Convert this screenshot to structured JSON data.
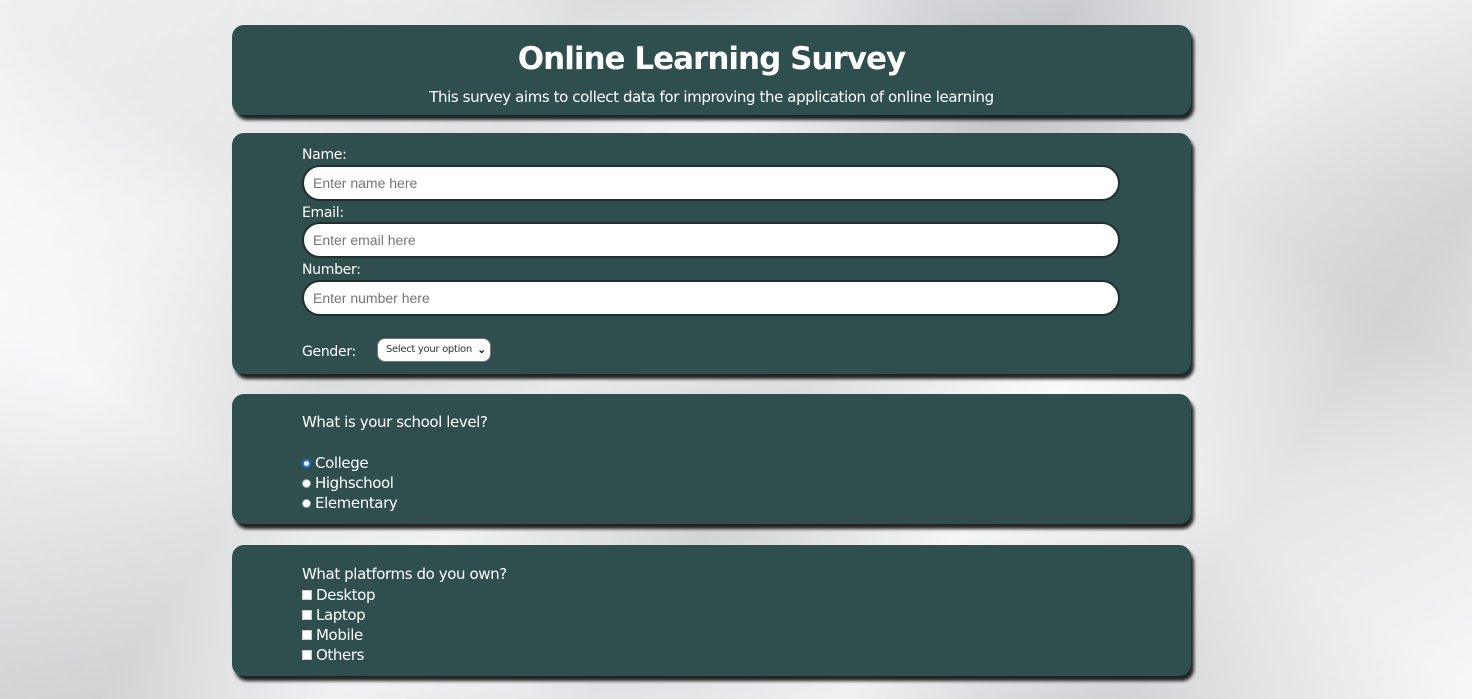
{
  "header": {
    "title": "Online Learning Survey",
    "subtitle": "This survey aims to collect data for improving the application of online learning"
  },
  "personal": {
    "name_label": "Name:",
    "name_placeholder": "Enter name here",
    "email_label": "Email:",
    "email_placeholder": "Enter email here",
    "number_label": "Number:",
    "number_placeholder": "Enter number here",
    "gender_label": "Gender:",
    "gender_selected": "Select your option"
  },
  "school": {
    "question": "What is your school level?",
    "options": [
      {
        "label": "College",
        "checked": true
      },
      {
        "label": "Highschool",
        "checked": false
      },
      {
        "label": "Elementary",
        "checked": false
      }
    ]
  },
  "platforms": {
    "question": "What platforms do you own?",
    "options": [
      {
        "label": "Desktop",
        "checked": false
      },
      {
        "label": "Laptop",
        "checked": false
      },
      {
        "label": "Mobile",
        "checked": false
      },
      {
        "label": "Others",
        "checked": false
      }
    ]
  },
  "colors": {
    "card_background": "#2f4f4f",
    "text": "#ffffff",
    "radio_focus": "#1a73e8"
  }
}
